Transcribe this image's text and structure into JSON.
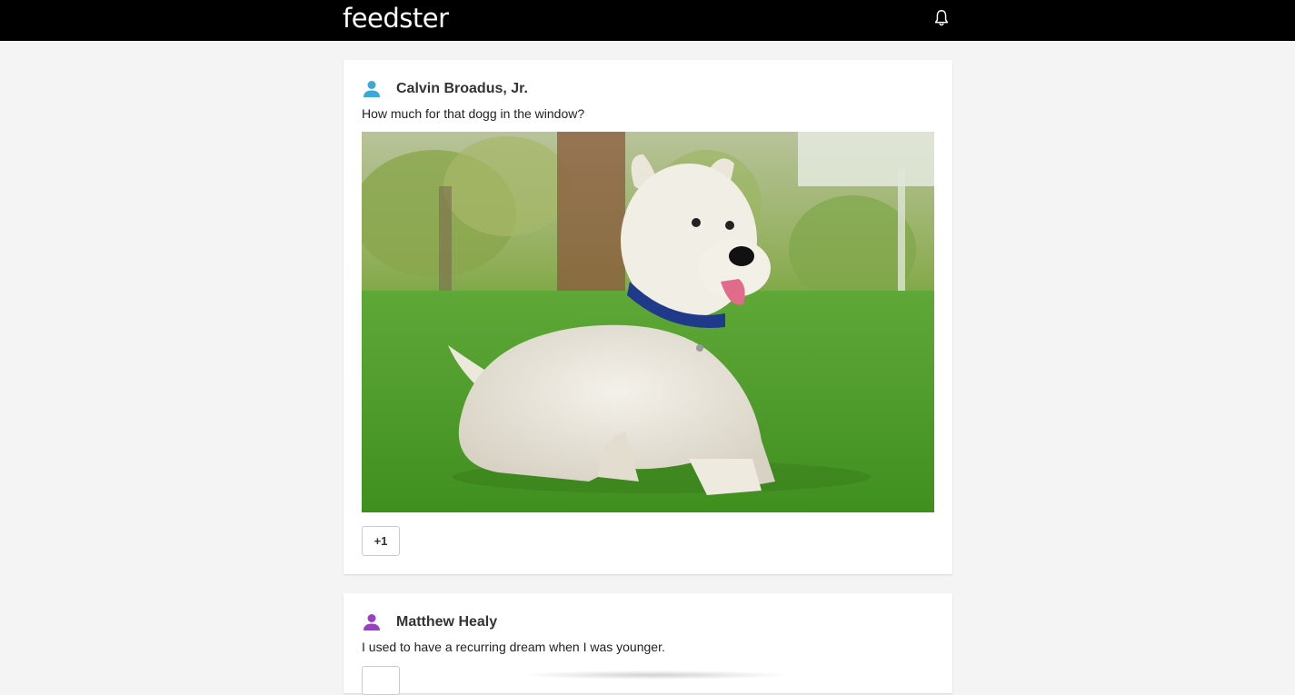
{
  "app": {
    "brand": "feedster"
  },
  "header": {
    "notifications_icon": "bell-icon"
  },
  "posts": [
    {
      "author": "Calvin Broadus, Jr.",
      "avatar_icon": "user-icon",
      "avatar_color": "#3aa8d8",
      "text": "How much for that dogg in the window?",
      "image_subject": "west-highland-terrier-on-grass",
      "plus_label": "+1"
    },
    {
      "author": "Matthew Healy",
      "avatar_icon": "user-icon",
      "avatar_color": "#9a3fc6",
      "text": "I used to have a recurring dream when I was younger."
    }
  ]
}
